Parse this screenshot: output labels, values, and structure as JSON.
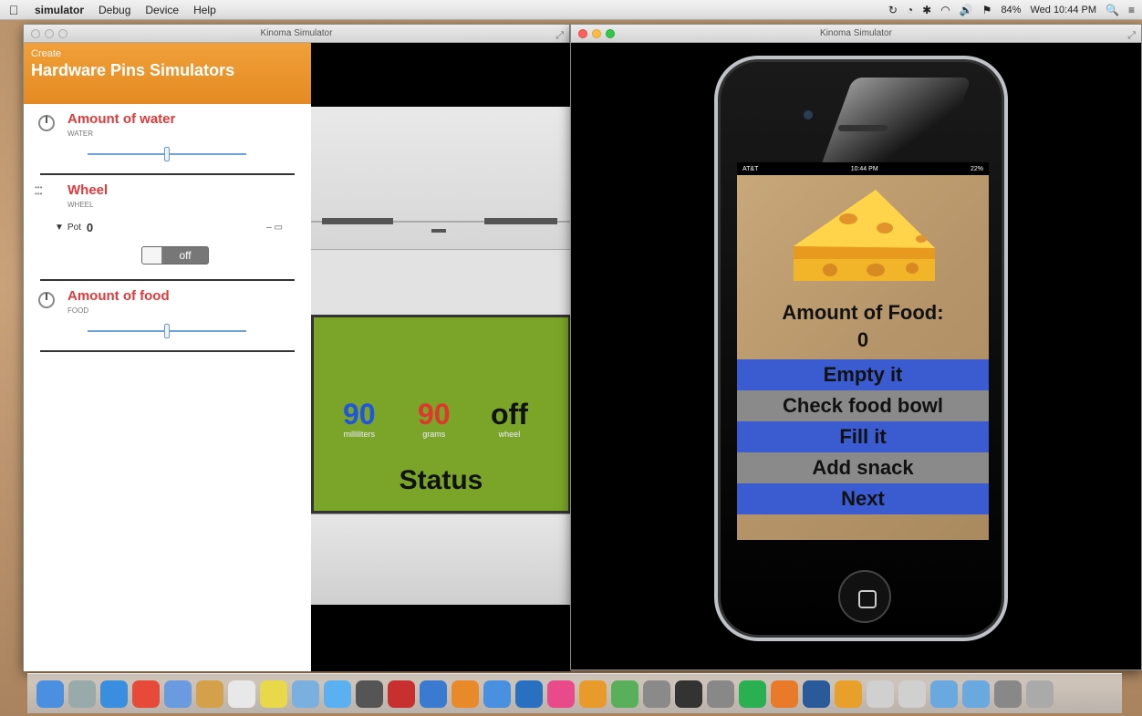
{
  "menubar": {
    "items": [
      "simulator",
      "Debug",
      "Device",
      "Help"
    ],
    "clock": "Wed 10:44 PM",
    "battery": "84%"
  },
  "window1": {
    "title": "Kinoma Simulator"
  },
  "window2": {
    "title": "Kinoma Simulator"
  },
  "panel": {
    "subtitle": "Create",
    "title": "Hardware Pins Simulators",
    "pins": [
      {
        "title": "Amount of water",
        "sub": "WATER",
        "slider": 0.5
      },
      {
        "title": "Wheel",
        "sub": "WHEEL",
        "pot_label": "Pot",
        "pot_value": "0",
        "toggle": "off"
      },
      {
        "title": "Amount of food",
        "sub": "FOOD",
        "slider": 0.5
      }
    ]
  },
  "device": {
    "readouts": [
      {
        "value": "90",
        "unit": "milliliters",
        "color": "#1f55e0"
      },
      {
        "value": "90",
        "unit": "grams",
        "color": "#e0362e"
      },
      {
        "value": "off",
        "unit": "wheel",
        "color": "#111111"
      }
    ],
    "status": "Status"
  },
  "phone": {
    "carrier": "AT&T",
    "time": "10:44 PM",
    "battery": "22%",
    "amount_label": "Amount of Food:",
    "amount_value": "0",
    "buttons": [
      {
        "label": "Empty it",
        "style": "blue"
      },
      {
        "label": "Check food bowl",
        "style": "gray"
      },
      {
        "label": "Fill it",
        "style": "blue"
      },
      {
        "label": "Add snack",
        "style": "gray"
      },
      {
        "label": "Next",
        "style": "blue"
      }
    ]
  },
  "dock": {
    "icons": [
      "finder-icon",
      "launchpad-icon",
      "safari-icon",
      "chrome-icon",
      "preview-icon",
      "notes-icon",
      "calendar-icon",
      "stickies-icon",
      "photos-icon",
      "messages-icon",
      "facetime-icon",
      "photo-booth-icon",
      "app-store-icon",
      "pages-icon",
      "keynote-icon",
      "xcode-icon",
      "itunes-icon",
      "ibooks-icon",
      "maps-icon",
      "digital-color-icon",
      "github-icon",
      "system-prefs-icon",
      "spotify-icon",
      "sublime-icon",
      "sgm-icon",
      "instruments-icon",
      "simulator-icon",
      "simulator2-icon",
      "folder-icon",
      "downloads-icon",
      "calculator-icon",
      "trash-icon"
    ],
    "colors": [
      "#4a8fe0",
      "#9aa",
      "#3a8ee0",
      "#e84a3a",
      "#6a9ae0",
      "#d4a04a",
      "#e8e8e8",
      "#e8d84a",
      "#7ab0e0",
      "#5ab0f0",
      "#555",
      "#c83030",
      "#3a7ad0",
      "#e88a2a",
      "#4a90e0",
      "#2a70c0",
      "#e84a8a",
      "#e89a2a",
      "#5ab05a",
      "#8a8a8a",
      "#333",
      "#888",
      "#2ab050",
      "#e87a2a",
      "#2a5a9a",
      "#e8a02a",
      "#d0d0d0",
      "#d0d0d0",
      "#6aa8e0",
      "#6aa8e0",
      "#888",
      "#aaa"
    ]
  }
}
